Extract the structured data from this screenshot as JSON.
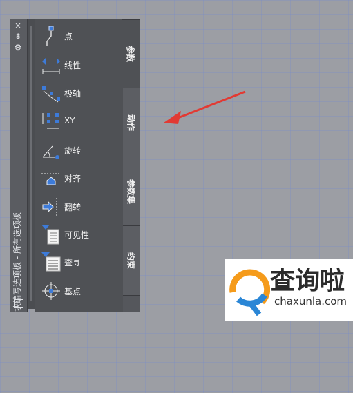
{
  "palette": {
    "title": "块编写选项板 - 所有选项板",
    "close_glyph": "×",
    "pin_glyph": "⇟",
    "props_glyph": "⚙"
  },
  "tabs": [
    {
      "label": "参数",
      "active": true
    },
    {
      "label": "动作",
      "active": false
    },
    {
      "label": "参数集",
      "active": false
    },
    {
      "label": "约束",
      "active": false
    }
  ],
  "tools": [
    {
      "label": "点",
      "icon": "point-param-icon"
    },
    {
      "label": "线性",
      "icon": "linear-param-icon"
    },
    {
      "label": "极轴",
      "icon": "polar-param-icon"
    },
    {
      "label": "XY",
      "icon": "xy-param-icon"
    },
    {
      "label": "旋转",
      "icon": "rotation-param-icon"
    },
    {
      "label": "对齐",
      "icon": "alignment-param-icon"
    },
    {
      "label": "翻转",
      "icon": "flip-param-icon"
    },
    {
      "label": "可见性",
      "icon": "visibility-param-icon"
    },
    {
      "label": "查寻",
      "icon": "lookup-param-icon"
    },
    {
      "label": "基点",
      "icon": "basepoint-param-icon"
    }
  ],
  "watermark": {
    "title": "查询啦",
    "url": "chaxunla.com",
    "colors": {
      "orange": "#f59b1b",
      "blue": "#2a86d6"
    }
  },
  "annotation": {
    "arrow_color": "#e23a33"
  }
}
